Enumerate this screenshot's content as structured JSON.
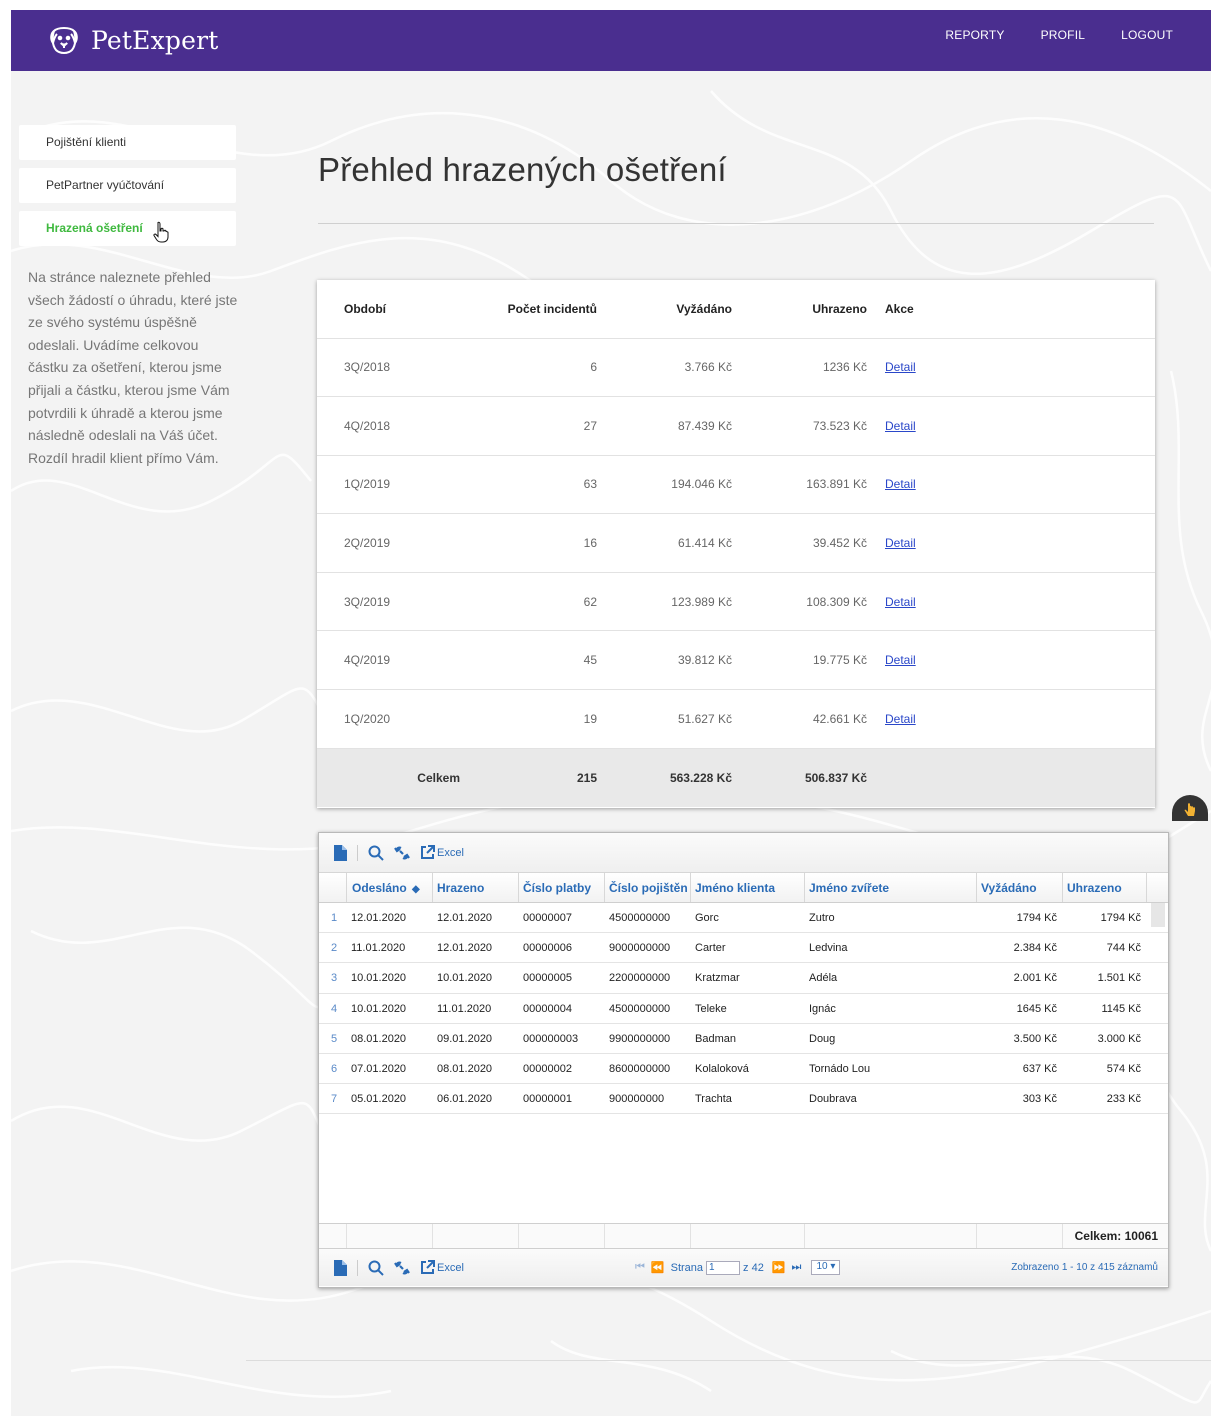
{
  "header": {
    "brand": "PetExpert",
    "nav": [
      "REPORTY",
      "PROFIL",
      "LOGOUT"
    ]
  },
  "sidebar": {
    "items": [
      {
        "label": "Pojištění klienti",
        "active": false
      },
      {
        "label": "PetPartner vyúčtování",
        "active": false
      },
      {
        "label": "Hrazená ošetření",
        "active": true
      }
    ],
    "description": "Na stránce naleznete přehled všech žádostí o úhradu, které jste ze svého systému úspěšně odeslali. Uvádíme celkovou částku za ošetření, kterou jsme přijali a částku, kterou jsme Vám potvrdili k úhradě a kterou jsme následně odeslali na Váš účet. Rozdíl hradil klient přímo Vám."
  },
  "page": {
    "title": "Přehled hrazených ošetření"
  },
  "summary": {
    "headers": [
      "Období",
      "Počet incidentů",
      "Vyžádáno",
      "Uhrazeno",
      "Akce"
    ],
    "rows": [
      {
        "period": "3Q/2018",
        "count": "6",
        "requested": "3.766 Kč",
        "paid": "1236 Kč",
        "action": "Detail"
      },
      {
        "period": "4Q/2018",
        "count": "27",
        "requested": "87.439 Kč",
        "paid": "73.523 Kč",
        "action": "Detail"
      },
      {
        "period": "1Q/2019",
        "count": "63",
        "requested": "194.046 Kč",
        "paid": "163.891 Kč",
        "action": "Detail"
      },
      {
        "period": "2Q/2019",
        "count": "16",
        "requested": "61.414 Kč",
        "paid": "39.452 Kč",
        "action": "Detail"
      },
      {
        "period": "3Q/2019",
        "count": "62",
        "requested": "123.989 Kč",
        "paid": "108.309 Kč",
        "action": "Detail"
      },
      {
        "period": "4Q/2019",
        "count": "45",
        "requested": "39.812 Kč",
        "paid": "19.775 Kč",
        "action": "Detail"
      },
      {
        "period": "1Q/2020",
        "count": "19",
        "requested": "51.627 Kč",
        "paid": "42.661 Kč",
        "action": "Detail"
      }
    ],
    "total": {
      "label": "Celkem",
      "count": "215",
      "requested": "563.228 Kč",
      "paid": "506.837 Kč"
    }
  },
  "grid": {
    "toolbar": {
      "excel": "Excel"
    },
    "columns": [
      "Odesláno",
      "Hrazeno",
      "Číslo platby",
      "Číslo pojištěn",
      "Jméno klienta",
      "Jméno zvířete",
      "Vyžádáno",
      "Uhrazeno"
    ],
    "sorted_column": "Odesláno",
    "rows": [
      [
        "1",
        "12.01.2020",
        "12.01.2020",
        "00000007",
        "4500000000",
        "Gorc",
        "Zutro",
        "1794 Kč",
        "1794 Kč"
      ],
      [
        "2",
        "11.01.2020",
        "12.01.2020",
        "00000006",
        "9000000000",
        "Carter",
        "Ledvina",
        "2.384 Kč",
        "744 Kč"
      ],
      [
        "3",
        "10.01.2020",
        "10.01.2020",
        "00000005",
        "2200000000",
        "Kratzmar",
        "Adéla",
        "2.001 Kč",
        "1.501 Kč"
      ],
      [
        "4",
        "10.01.2020",
        "11.01.2020",
        "00000004",
        "4500000000",
        "Teleke",
        "Ignác",
        "1645 Kč",
        "1145 Kč"
      ],
      [
        "5",
        "08.01.2020",
        "09.01.2020",
        "000000003",
        "9900000000",
        "Badman",
        "Doug",
        "3.500 Kč",
        "3.000 Kč"
      ],
      [
        "6",
        "07.01.2020",
        "08.01.2020",
        "00000002",
        "8600000000",
        "Kolaloková",
        "Tornádo Lou",
        "637 Kč",
        "574 Kč"
      ],
      [
        "7",
        "05.01.2020",
        "06.01.2020",
        "00000001",
        "900000000",
        "Trachta",
        "Doubrava",
        "303 Kč",
        "233 Kč"
      ]
    ],
    "footer_total": "Celkem: 10061",
    "pager": {
      "page_label": "Strana",
      "page_value": "1",
      "of_label": "z 42",
      "page_size": "10",
      "info": "Zobrazeno 1 - 10 z 415 záznamů"
    }
  }
}
